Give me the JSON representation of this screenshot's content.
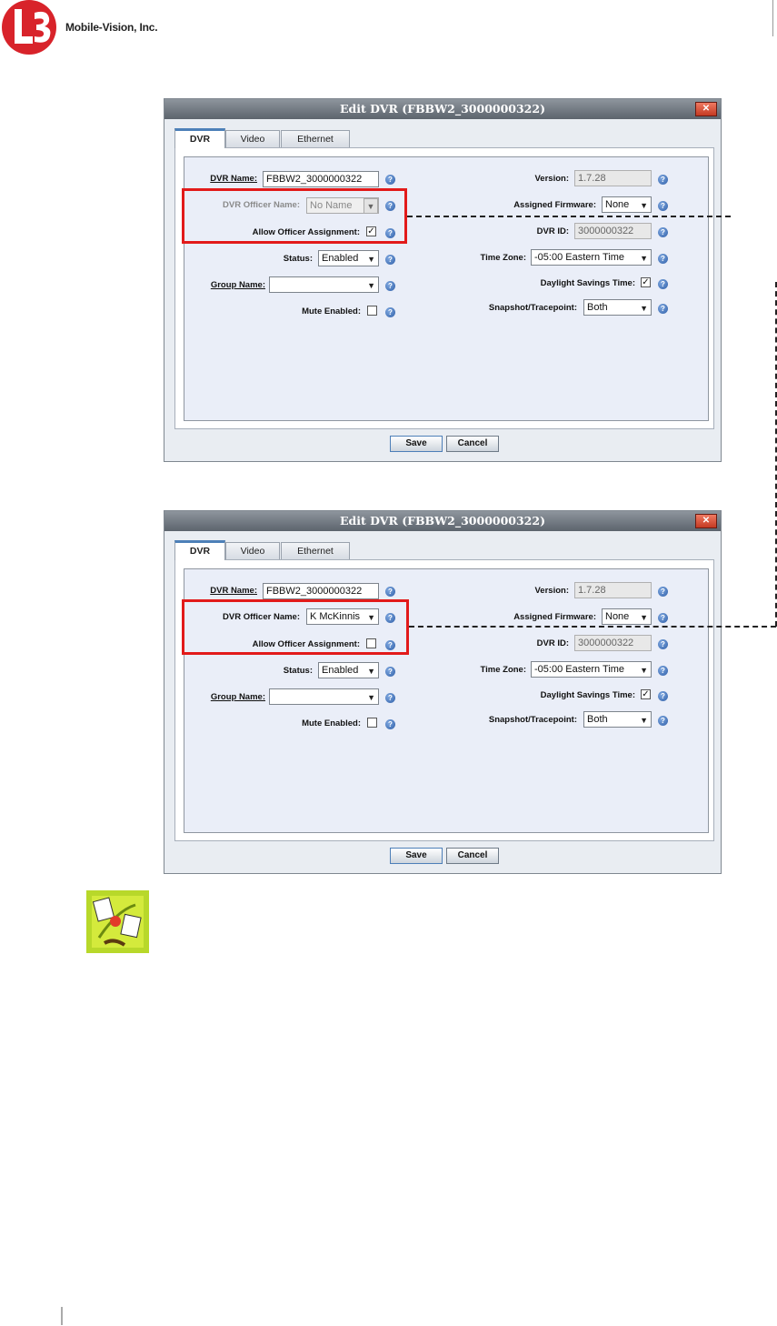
{
  "brand": {
    "company": "Mobile-Vision, Inc."
  },
  "dialogs": [
    {
      "title": "Edit DVR (FBBW2_3000000322)",
      "tabs": [
        "DVR",
        "Video",
        "Ethernet"
      ],
      "left": {
        "dvr_name_label": "DVR Name:",
        "dvr_name_value": "FBBW2_3000000322",
        "officer_label": "DVR Officer Name:",
        "officer_value": "No Name",
        "allow_label": "Allow Officer Assignment:",
        "allow_mark": "✓",
        "status_label": "Status:",
        "status_value": "Enabled",
        "group_label": "Group Name:",
        "group_value": "",
        "mute_label": "Mute Enabled:",
        "mute_mark": ""
      },
      "right": {
        "version_label": "Version:",
        "version_value": "1.7.28",
        "firmware_label": "Assigned Firmware:",
        "firmware_value": "None",
        "dvrid_label": "DVR ID:",
        "dvrid_value": "3000000322",
        "timezone_label": "Time Zone:",
        "timezone_value": "-05:00 Eastern Time",
        "dst_label": "Daylight Savings Time:",
        "dst_mark": "✓",
        "snapshot_label": "Snapshot/Tracepoint:",
        "snapshot_value": "Both"
      },
      "buttons": {
        "save": "Save",
        "cancel": "Cancel"
      }
    },
    {
      "title": "Edit DVR (FBBW2_3000000322)",
      "tabs": [
        "DVR",
        "Video",
        "Ethernet"
      ],
      "left": {
        "dvr_name_label": "DVR Name:",
        "dvr_name_value": "FBBW2_3000000322",
        "officer_label": "DVR Officer Name:",
        "officer_value": "K McKinnis",
        "allow_label": "Allow Officer Assignment:",
        "allow_mark": "",
        "status_label": "Status:",
        "status_value": "Enabled",
        "group_label": "Group Name:",
        "group_value": "",
        "mute_label": "Mute Enabled:",
        "mute_mark": ""
      },
      "right": {
        "version_label": "Version:",
        "version_value": "1.7.28",
        "firmware_label": "Assigned Firmware:",
        "firmware_value": "None",
        "dvrid_label": "DVR ID:",
        "dvrid_value": "3000000322",
        "timezone_label": "Time Zone:",
        "timezone_value": "-05:00 Eastern Time",
        "dst_label": "Daylight Savings Time:",
        "dst_mark": "✓",
        "snapshot_label": "Snapshot/Tracepoint:",
        "snapshot_value": "Both"
      },
      "buttons": {
        "save": "Save",
        "cancel": "Cancel"
      }
    }
  ],
  "icons": {
    "logo": "l3-logo",
    "help": "help-icon",
    "note": "note-icon"
  },
  "colors": {
    "highlight": "#e21a1a",
    "tab_accent": "#4d80b8",
    "help_blue": "#2f5fa8"
  }
}
